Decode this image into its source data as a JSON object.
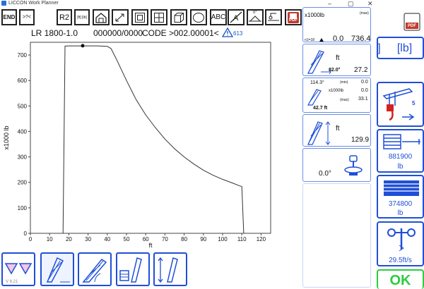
{
  "window": {
    "title": "LICCON Work Planner"
  },
  "toolbar": {
    "end": "END",
    "question": ">?<",
    "r2": "R2",
    "units": "[ft] [lb]",
    "abc": "ABC",
    "angle_zero": "0°",
    "pdf": "PDF"
  },
  "status": {
    "model": "LR 1800-1.0",
    "number": "000000/0000",
    "code": "CODE >002.00001<",
    "warning_count": "613"
  },
  "chart_data": {
    "type": "line",
    "xlabel": "ft",
    "ylabel": "x1000 lb",
    "xlim": [
      0,
      125
    ],
    "ylim": [
      0,
      750
    ],
    "xticks": [
      0,
      10,
      20,
      30,
      40,
      50,
      60,
      70,
      80,
      90,
      100,
      110,
      120
    ],
    "yticks": [
      0,
      100,
      200,
      300,
      400,
      500,
      600,
      700
    ],
    "grid": false,
    "x": [
      17,
      18,
      20,
      25,
      30,
      35,
      40,
      42,
      45,
      50,
      55,
      60,
      65,
      70,
      75,
      80,
      85,
      90,
      95,
      100,
      105,
      109,
      110,
      111
    ],
    "y": [
      0,
      735,
      736,
      736,
      736,
      736,
      734,
      725,
      680,
      600,
      525,
      465,
      415,
      370,
      332,
      300,
      272,
      248,
      228,
      212,
      198,
      186,
      184,
      0
    ],
    "marker": {
      "x": 27.2,
      "y": 736.4
    }
  },
  "panel_load": {
    "unit": "x1000lb",
    "max_label": "(max)",
    "reeving": "n1=18",
    "min_value": "0.0",
    "value": "736.4"
  },
  "panel_radius": {
    "unit": "ft",
    "angle": "82.0°",
    "value": "27.2"
  },
  "panel_counter": {
    "angle": "114.3°",
    "min_label": "(min)",
    "min_value": "0.0",
    "unit": "x1000lb",
    "mid_value": "0.0",
    "max_label": "(max)",
    "max_value": "33.1",
    "length": "42.7 ft"
  },
  "panel_height": {
    "unit": "ft",
    "value": "129.9"
  },
  "panel_slew": {
    "value": "0.0°"
  },
  "right_column": {
    "units": "[lb]",
    "bracket": "]",
    "pdf": "PDF",
    "crane_number": "5",
    "counterweight1_value": "881900",
    "counterweight1_unit": "lb",
    "counterweight2_value": "374800",
    "counterweight2_unit": "lb",
    "wind_value": "29.5ft/s",
    "ok_label": "OK"
  },
  "footer": {
    "version": "V 6.21"
  },
  "colors": {
    "accent": "#1f4fd8",
    "pdf": "#c0392b",
    "ok": "#2ecc40"
  }
}
